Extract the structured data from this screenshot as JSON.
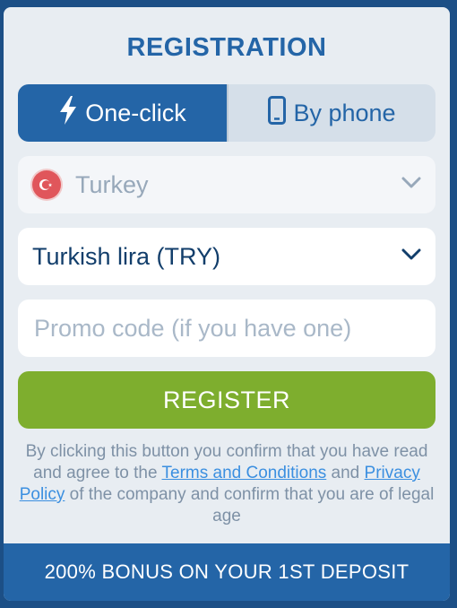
{
  "title": "REGISTRATION",
  "tabs": [
    {
      "label": "One-click",
      "icon": "lightning-icon",
      "active": true
    },
    {
      "label": "By phone",
      "icon": "phone-icon",
      "active": false
    }
  ],
  "country": {
    "value": "Turkey",
    "flag": "turkey-flag-icon"
  },
  "currency": {
    "value": "Turkish lira (TRY)"
  },
  "promo": {
    "placeholder": "Promo code (if you have one)",
    "value": ""
  },
  "register_label": "REGISTER",
  "disclaimer": {
    "part1": "By clicking this button you confirm that you have read and agree to the ",
    "terms_link": "Terms and Conditions",
    "part2": " and ",
    "privacy_link": "Privacy Policy",
    "part3": " of the company and confirm that you are of legal age"
  },
  "bonus": "200% BONUS ON YOUR 1ST DEPOSIT",
  "colors": {
    "primary": "#2465a7",
    "register": "#7eae2e",
    "background": "#e8edf2",
    "link": "#3b8fe0"
  }
}
